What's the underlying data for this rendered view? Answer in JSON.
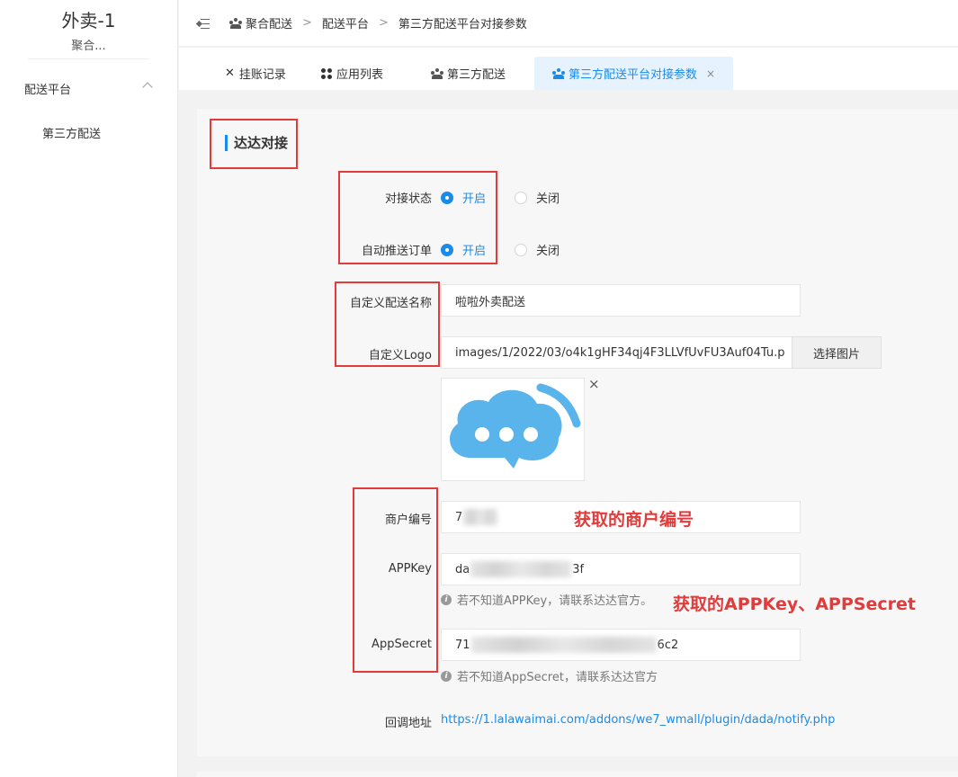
{
  "sidebar": {
    "title": "外卖-1",
    "subtitle": "聚合...",
    "group_label": "配送平台",
    "sub_item": "第三方配送"
  },
  "breadcrumb": {
    "item1": "聚合配送",
    "item2": "配送平台",
    "item3": "第三方配送平台对接参数",
    "separator": ">"
  },
  "tabs": [
    {
      "label": "挂账记录",
      "icon": "tools-icon"
    },
    {
      "label": "应用列表",
      "icon": "grid-icon"
    },
    {
      "label": "第三方配送",
      "icon": "people-icon"
    },
    {
      "label": "第三方配送平台对接参数",
      "icon": "people-icon",
      "active": true
    }
  ],
  "tab_close": "×",
  "section": {
    "title": "达达对接"
  },
  "form": {
    "status_label": "对接状态",
    "status_on": "开启",
    "status_off": "关闭",
    "auto_push_label": "自动推送订单",
    "auto_push_on": "开启",
    "auto_push_off": "关闭",
    "name_label": "自定义配送名称",
    "name_value": "啦啦外卖配送",
    "logo_label": "自定义Logo",
    "logo_value": "images/1/2022/03/o4k1gHF34qj4F3LLVfUvFU3Auf04Tu.p",
    "pick_button": "选择图片",
    "thumb_close": "×",
    "merchant_label": "商户编号",
    "merchant_prefix": "7",
    "appkey_label": "APPKey",
    "appkey_prefix": "da",
    "appkey_suffix": "3f",
    "appkey_hint": "若不知道APPKey，请联系达达官方。",
    "appsecret_label": "AppSecret",
    "appsecret_prefix": "71",
    "appsecret_suffix": "6c2",
    "appsecret_hint": "若不知道AppSecret，请联系达达官方",
    "callback_label": "回调地址",
    "callback_url": "https://1.lalawaimai.com/addons/we7_wmall/plugin/dada/notify.php"
  },
  "annotations": {
    "merchant": "获取的商户编号",
    "keys": "获取的APPKey、APPSecret"
  },
  "colors": {
    "primary": "#1b8be9",
    "annotation": "#e23b3b",
    "logo_cloud": "#5ab4ec"
  }
}
